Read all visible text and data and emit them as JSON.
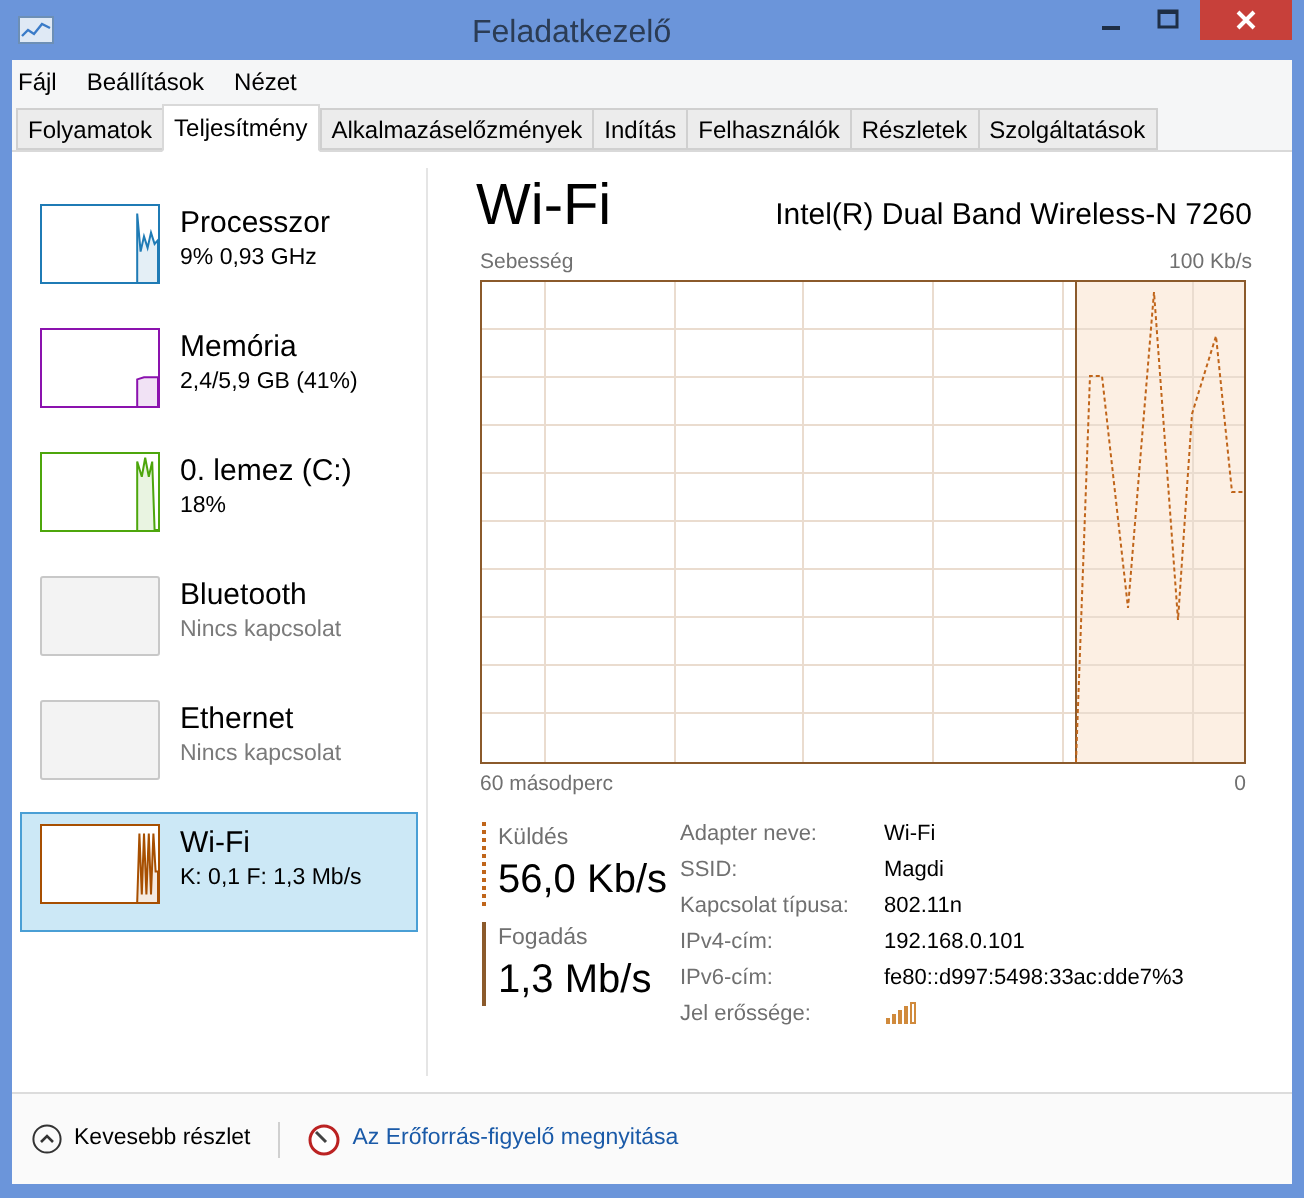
{
  "window": {
    "title": "Feladatkezelő"
  },
  "menu": [
    "Fájl",
    "Beállítások",
    "Nézet"
  ],
  "tabs": [
    {
      "label": "Folyamatok",
      "selected": false
    },
    {
      "label": "Teljesítmény",
      "selected": true
    },
    {
      "label": "Alkalmazáselőzmények",
      "selected": false
    },
    {
      "label": "Indítás",
      "selected": false
    },
    {
      "label": "Felhasználók",
      "selected": false
    },
    {
      "label": "Részletek",
      "selected": false
    },
    {
      "label": "Szolgáltatások",
      "selected": false
    }
  ],
  "sidebar": {
    "items": [
      {
        "name": "Processzor",
        "detail": "9%  0,93 GHz",
        "kind": "graph",
        "color": "#1f7bb5",
        "selected": false
      },
      {
        "name": "Memória",
        "detail": "2,4/5,9 GB (41%)",
        "kind": "graph",
        "color": "#8b12ae",
        "selected": false
      },
      {
        "name": "0. lemez (C:)",
        "detail": "18%",
        "kind": "graph",
        "color": "#4da60c",
        "selected": false
      },
      {
        "name": "Bluetooth",
        "detail": "Nincs kapcsolat",
        "kind": "inactive",
        "selected": false
      },
      {
        "name": "Ethernet",
        "detail": "Nincs kapcsolat",
        "kind": "inactive",
        "selected": false
      },
      {
        "name": "Wi-Fi",
        "detail": "K: 0,1 F: 1,3 Mb/s",
        "kind": "graph",
        "color": "#a74f01",
        "selected": true
      }
    ]
  },
  "detail": {
    "title": "Wi-Fi",
    "adapter": "Intel(R) Dual Band Wireless-N 7260",
    "graph": {
      "label": "Sebesség",
      "max_label": "100 Kb/s",
      "time_label": "60 másodperc",
      "end_label": "0"
    },
    "throughput": [
      {
        "label": "Küldés",
        "value": "56,0 Kb/s",
        "kind": "dotted"
      },
      {
        "label": "Fogadás",
        "value": "1,3 Mb/s",
        "kind": "solid"
      }
    ],
    "properties": [
      {
        "label": "Adapter neve:",
        "value": "Wi-Fi"
      },
      {
        "label": "SSID:",
        "value": "Magdi"
      },
      {
        "label": "Kapcsolat típusa:",
        "value": "802.11n"
      },
      {
        "label": "IPv4-cím:",
        "value": "192.168.0.101"
      },
      {
        "label": "IPv6-cím:",
        "value": "fe80::d997:5498:33ac:dde7%3"
      },
      {
        "label": "Jel erőssége:",
        "kind": "signal"
      }
    ]
  },
  "footer": {
    "fewer_details": "Kevesebb részlet",
    "resource_monitor": "Az Erőforrás-figyelő megnyitása"
  }
}
